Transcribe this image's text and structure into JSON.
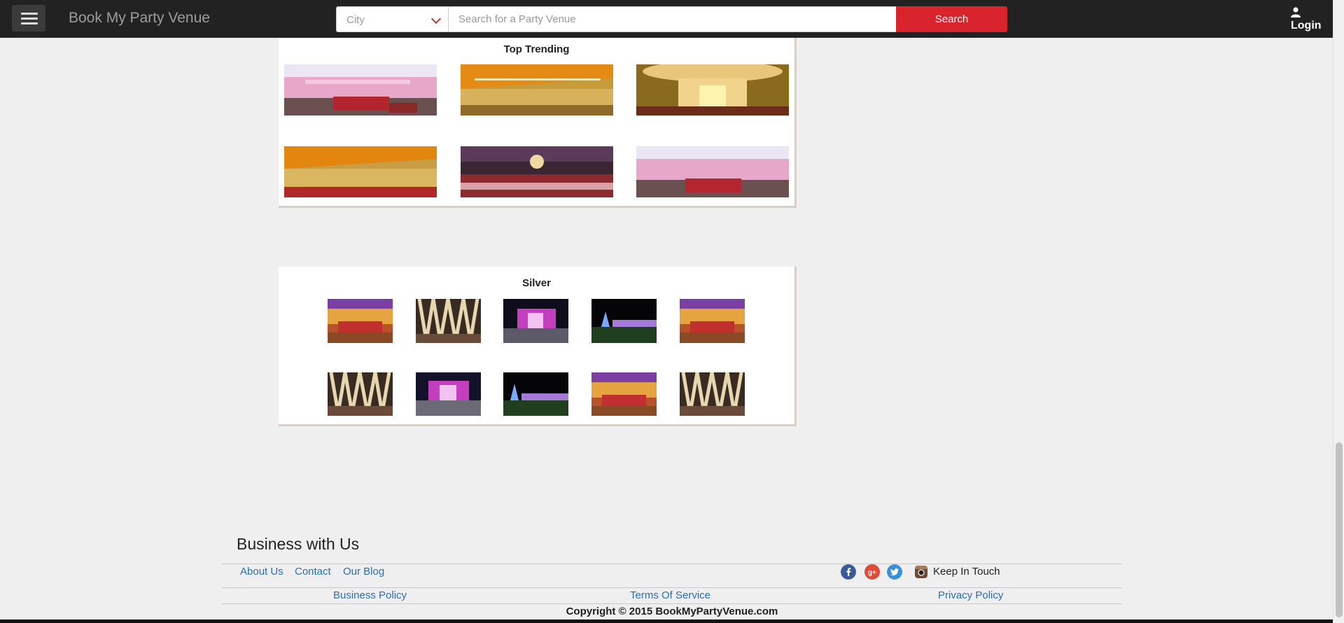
{
  "header": {
    "brand": "Book My Party Venue",
    "city_placeholder": "City",
    "search_placeholder": "Search for a Party Venue",
    "search_label": "Search",
    "login_label": "Login"
  },
  "top_trending": {
    "title": "Top Trending"
  },
  "silver": {
    "title": "Silver"
  },
  "footer": {
    "title": "Business with Us",
    "links": [
      "About Us",
      "Contact",
      "Our Blog"
    ],
    "keep_in_touch": "Keep In Touch",
    "policy_links": [
      "Business Policy",
      "Terms Of Service",
      "Privacy Policy"
    ],
    "copyright": "Copyright © 2015 BookMyPartyVenue.com",
    "social_icons": [
      "facebook-icon",
      "google-plus-icon",
      "twitter-icon",
      "instagram-icon"
    ]
  },
  "colors": {
    "search_button": "#d9232d",
    "link": "#2a6fb0",
    "topbar": "#222222"
  }
}
